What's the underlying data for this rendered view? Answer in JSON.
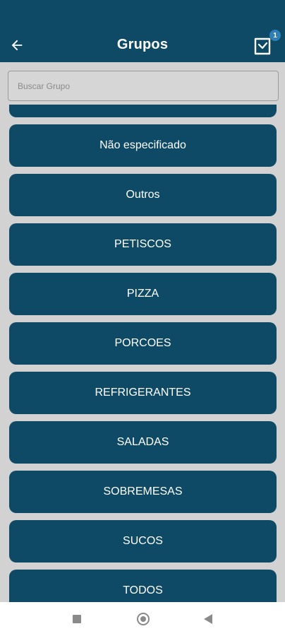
{
  "header": {
    "title": "Grupos",
    "back_icon": "arrow-left-icon",
    "cart_icon": "shopping-cart-icon",
    "cart_badge": "1",
    "background_color": "#0e4a66"
  },
  "search": {
    "placeholder": "Buscar Grupo",
    "value": ""
  },
  "groups": [
    "",
    "Não especificado",
    "Outros",
    "PETISCOS",
    "PIZZA",
    "PORCOES",
    "REFRIGERANTES",
    "SALADAS",
    "SOBREMESAS",
    "SUCOS",
    "TODOS"
  ],
  "system_nav": {
    "icons": [
      "recents-square-icon",
      "home-circle-icon",
      "back-triangle-icon"
    ]
  }
}
